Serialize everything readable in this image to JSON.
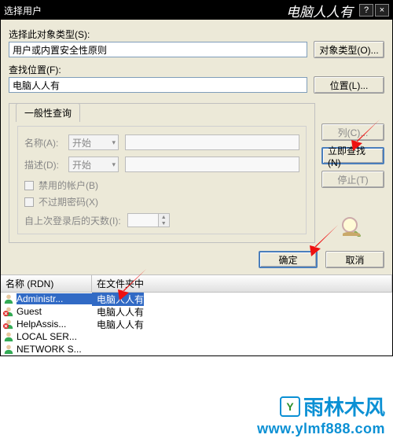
{
  "titlebar": {
    "title": "选择用户",
    "brand": "电脑人人有",
    "help": "?",
    "close": "×"
  },
  "labels": {
    "object_type": "选择此对象类型(S):",
    "object_type_btn": "对象类型(O)...",
    "location": "查找位置(F):",
    "location_btn": "位置(L)...",
    "tab_general": "一般性查询",
    "name": "名称(A):",
    "desc": "描述(D):",
    "begins": "开始",
    "disabled_acct": "禁用的帐户(B)",
    "pwd_never": "不过期密码(X)",
    "days_since": "自上次登录后的天数(I):",
    "col_btn": "列(C)...",
    "find_now": "立即查找(N)",
    "stop": "停止(T)",
    "ok": "确定",
    "cancel": "取消"
  },
  "fields": {
    "object_type_value": "用户或内置安全性原则",
    "location_value": "电脑人人有"
  },
  "list": {
    "col_name": "名称 (RDN)",
    "col_folder": "在文件夹中",
    "rows": [
      {
        "name": "Administr...",
        "folder": "电脑人人有",
        "selected": true,
        "icon": "user"
      },
      {
        "name": "Guest",
        "folder": "电脑人人有",
        "selected": false,
        "icon": "user-x"
      },
      {
        "name": "HelpAssis...",
        "folder": "电脑人人有",
        "selected": false,
        "icon": "user-x"
      },
      {
        "name": "LOCAL SER...",
        "folder": "",
        "selected": false,
        "icon": "user"
      },
      {
        "name": "NETWORK S...",
        "folder": "",
        "selected": false,
        "icon": "user"
      }
    ]
  },
  "watermark": {
    "brand": "雨林木风",
    "url": "www.ylmf888.com"
  }
}
